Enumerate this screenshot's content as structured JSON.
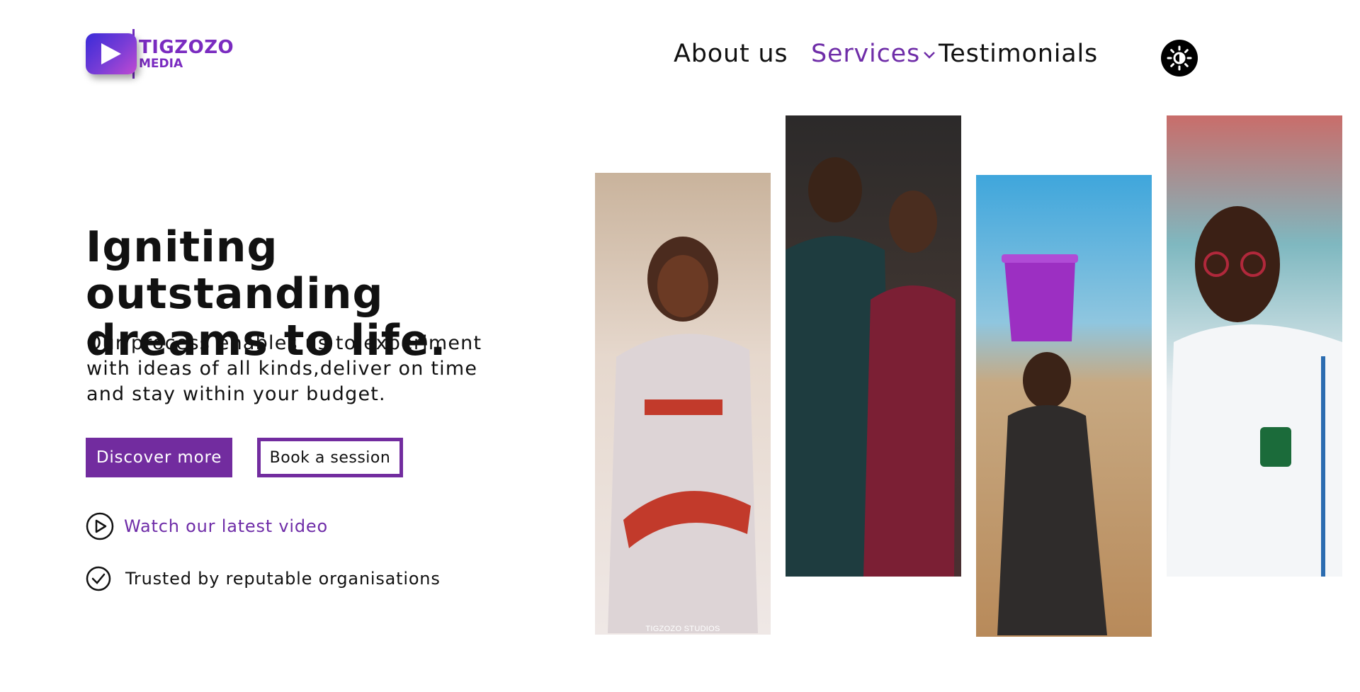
{
  "brand": {
    "name_line1": "TIGZOZO",
    "name_line2": "MEDIA",
    "accent_color": "#722c9f"
  },
  "nav": {
    "about": "About us",
    "services": "Services",
    "testimonials": "Testimonials",
    "theme_toggle_icon": "sun-icon"
  },
  "hero": {
    "headline": "Igniting outstanding dreams to life.",
    "subtext": "Our process enables us to experiment with ideas of all kinds,deliver on time and stay within your budget.",
    "primary_button": "Discover more",
    "secondary_button": "Book a session",
    "video_link": "Watch our latest video",
    "trusted_text": "Trusted by reputable organisations"
  },
  "gallery": {
    "photos": [
      {
        "subject": "woman-in-dress-portrait",
        "watermark": "TIGZOZO STUDIOS"
      },
      {
        "subject": "couple-portrait"
      },
      {
        "subject": "child-carrying-bucket"
      },
      {
        "subject": "student-in-uniform"
      }
    ]
  }
}
